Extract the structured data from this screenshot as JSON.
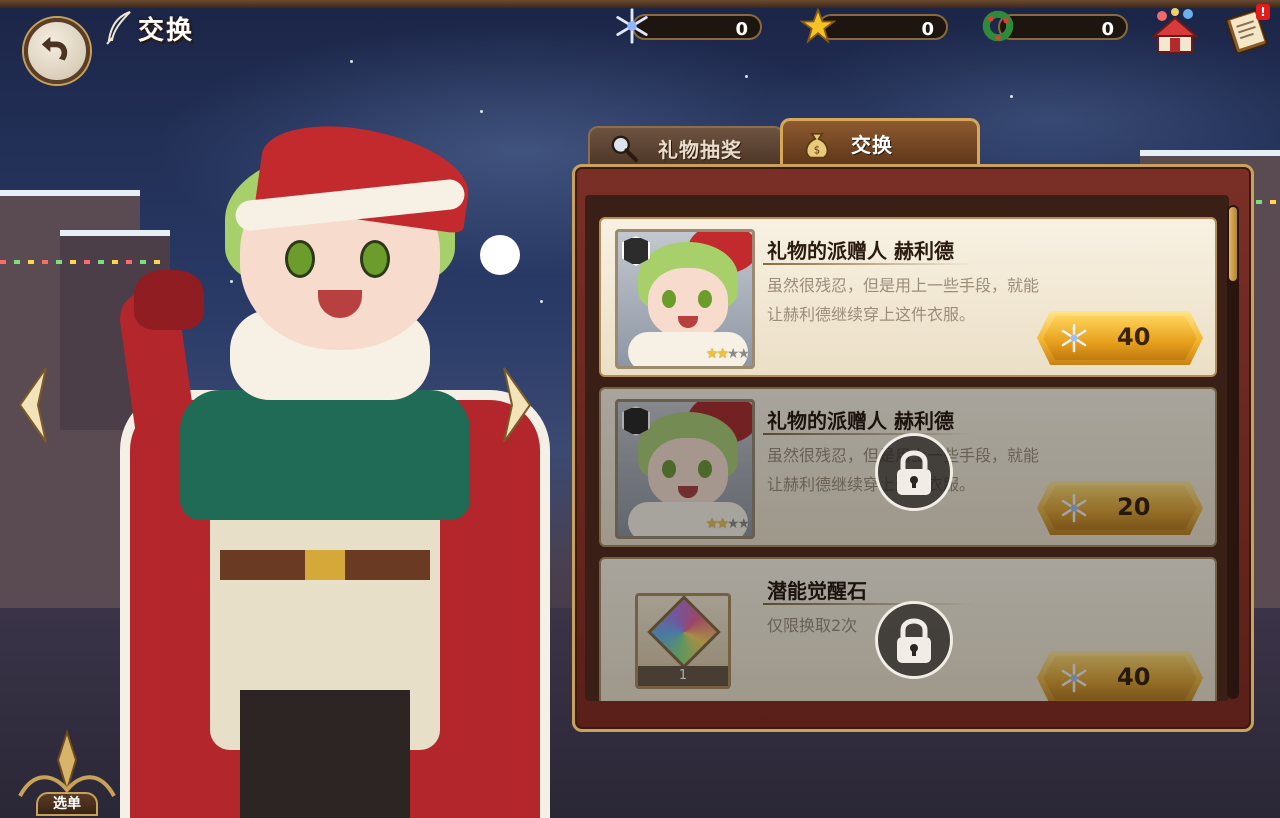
{
  "header": {
    "title": "交换"
  },
  "currencies": [
    {
      "icon": "snowflake-icon",
      "value": "0"
    },
    {
      "icon": "star-icon",
      "value": "0"
    },
    {
      "icon": "wreath-icon",
      "value": "0"
    }
  ],
  "notification_badge": "!",
  "tabs": [
    {
      "label": "礼物抽奖",
      "icon": "magnifier-icon",
      "active": false
    },
    {
      "label": "交换",
      "icon": "money-bag-icon",
      "active": true
    }
  ],
  "items": [
    {
      "title": "礼物的派赠人 赫利德",
      "description": "虽然很残忍，但是用上一些手段，就能让赫利德继续穿上这件衣服。",
      "price": "40",
      "stars": 2,
      "max_stars": 4,
      "locked": false,
      "type": "costume"
    },
    {
      "title": "礼物的派赠人 赫利德",
      "description": "虽然很残忍，但是用上一些手段，就能让赫利德继续穿上这件衣服。",
      "price": "20",
      "stars": 2,
      "max_stars": 4,
      "locked": true,
      "type": "costume"
    },
    {
      "title": "潜能觉醒石",
      "description": "仅限换取2次",
      "price": "40",
      "count": "1",
      "locked": true,
      "type": "item"
    }
  ],
  "menu": {
    "label": "选单"
  },
  "colors": {
    "accent_gold": "#f3b52e",
    "panel_red": "#7a2f26",
    "card_bg": "#f8f1e2"
  }
}
